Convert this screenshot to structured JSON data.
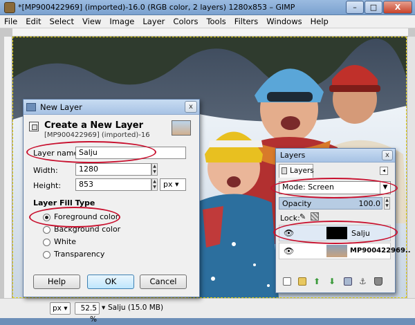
{
  "window": {
    "title": "*[MP900422969] (imported)-16.0 (RGB color, 2 layers) 1280x853 – GIMP",
    "buttons": {
      "minimize": "–",
      "maximize": "□",
      "close": "X"
    }
  },
  "menu": [
    "File",
    "Edit",
    "Select",
    "View",
    "Image",
    "Layer",
    "Colors",
    "Tools",
    "Filters",
    "Windows",
    "Help"
  ],
  "status": {
    "unit": "px",
    "zoom": "52.5 %",
    "layer_info": "Salju (15.0 MB)"
  },
  "dialog": {
    "title": "New Layer",
    "heading": "Create a New Layer",
    "subheading": "[MP900422969] (imported)-16",
    "layer_name_label": "Layer name:",
    "layer_name_value": "Salju",
    "width_label": "Width:",
    "width_value": "1280",
    "height_label": "Height:",
    "height_value": "853",
    "unit": "px",
    "fill_type_label": "Layer Fill Type",
    "fill_options": [
      "Foreground color",
      "Background color",
      "White",
      "Transparency"
    ],
    "fill_selected": 0,
    "buttons": {
      "help": "Help",
      "ok": "OK",
      "cancel": "Cancel"
    },
    "close": "x"
  },
  "layers": {
    "title": "Layers",
    "tab": "Layers",
    "mode_label": "Mode: Screen",
    "opacity_label": "Opacity",
    "opacity_value": "100.0",
    "lock_label": "Lock:",
    "items": [
      {
        "name": "Salju",
        "selected": true
      },
      {
        "name": "MP900422969..",
        "selected": false
      }
    ],
    "close": "x"
  },
  "colors": {
    "annotation": "#c8102e",
    "accent": "#6d8fb8"
  }
}
